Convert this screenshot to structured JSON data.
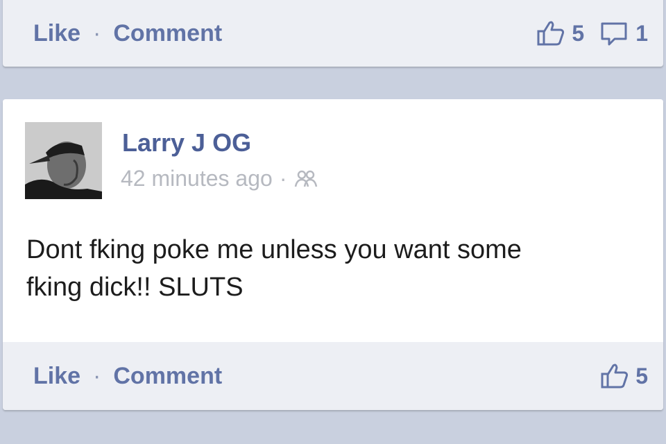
{
  "colors": {
    "feed_background": "#c9d0df",
    "action_bar": "#edeff4",
    "link_blue": "#6173a6",
    "author_blue": "#4c5f97",
    "meta_gray": "#b6b9c0"
  },
  "previous_post": {
    "like_label": "Like",
    "separator": "·",
    "comment_label": "Comment",
    "like_count": "5",
    "comment_count": "1"
  },
  "post": {
    "author": "Larry J OG",
    "timestamp": "42 minutes ago",
    "separator": "·",
    "audience_icon": "friends-icon",
    "message_line1": "Dont fking poke me unless you want some",
    "message_line2": "fking dick!! SLUTS",
    "like_label": "Like",
    "comment_label": "Comment",
    "like_count": "5"
  }
}
